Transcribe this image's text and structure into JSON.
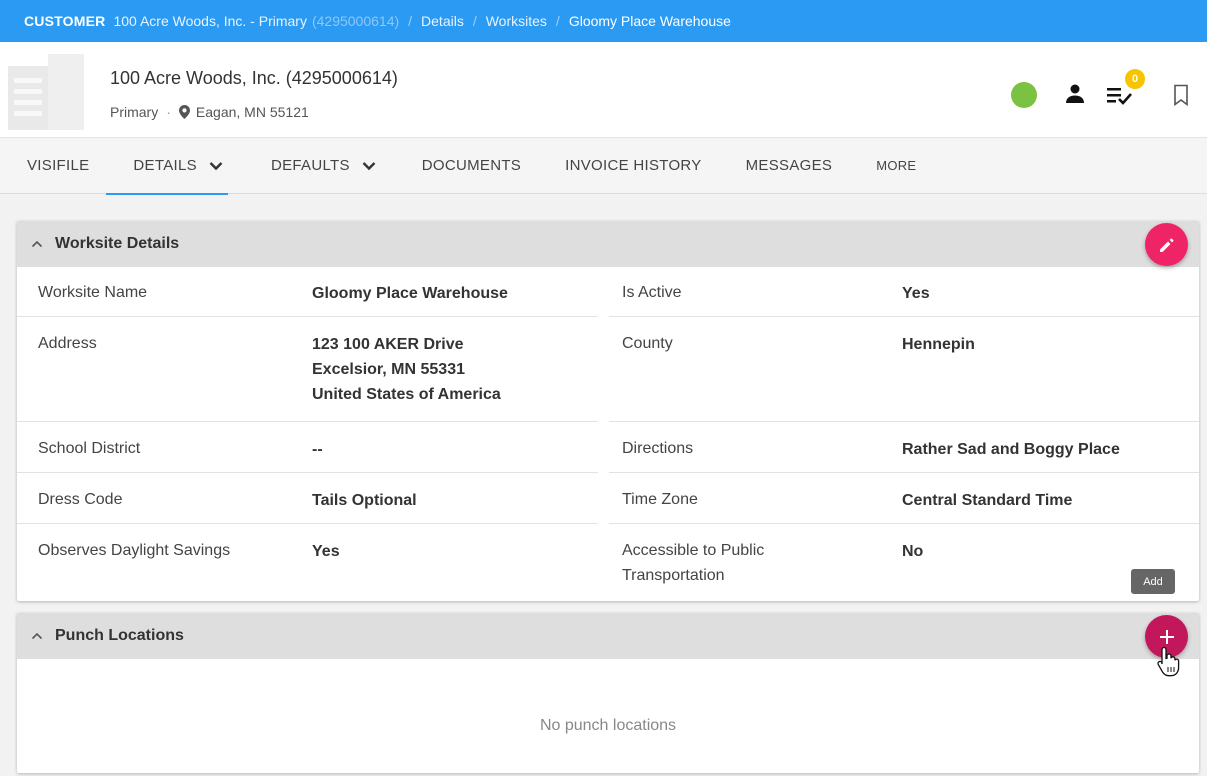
{
  "breadcrumb": {
    "type": "CUSTOMER",
    "customer": "100 Acre Woods, Inc. - Primary",
    "customer_id": "(4295000614)",
    "items": [
      "Details",
      "Worksites"
    ],
    "current": "Gloomy Place Warehouse"
  },
  "header": {
    "title": "100 Acre Woods, Inc. (4295000614)",
    "subtitle_type": "Primary",
    "subtitle_dot": "·",
    "location": "Eagan, MN 55121",
    "status_color": "#7cc242",
    "todo_badge": "0"
  },
  "tabs": [
    {
      "label": "VISIFILE"
    },
    {
      "label": "DETAILS"
    },
    {
      "label": "DEFAULTS"
    },
    {
      "label": "DOCUMENTS"
    },
    {
      "label": "INVOICE HISTORY"
    },
    {
      "label": "MESSAGES"
    },
    {
      "label": "MORE"
    }
  ],
  "worksite": {
    "title": "Worksite Details",
    "name_label": "Worksite Name",
    "name_value": "Gloomy Place Warehouse",
    "active_label": "Is Active",
    "active_value": "Yes",
    "address_label": "Address",
    "address_line1": "123 100 AKER Drive",
    "address_line2": "Excelsior, MN 55331",
    "address_line3": "United States of America",
    "county_label": "County",
    "county_value": "Hennepin",
    "school_label": "School District",
    "school_value": "--",
    "directions_label": "Directions",
    "directions_value": "Rather Sad and Boggy Place",
    "dress_label": "Dress Code",
    "dress_value": "Tails Optional",
    "tz_label": "Time Zone",
    "tz_value": "Central Standard Time",
    "dst_label": "Observes Daylight Savings",
    "dst_value": "Yes",
    "transit_label_1": "Accessible to Public",
    "transit_label_2": "Transportation",
    "transit_value": "No"
  },
  "tooltip": "Add",
  "punch": {
    "title": "Punch Locations",
    "empty": "No punch locations"
  },
  "colors": {
    "accent": "#2b9af3",
    "edit_fab": "#ef2467",
    "add_fab": "#c2185b"
  }
}
